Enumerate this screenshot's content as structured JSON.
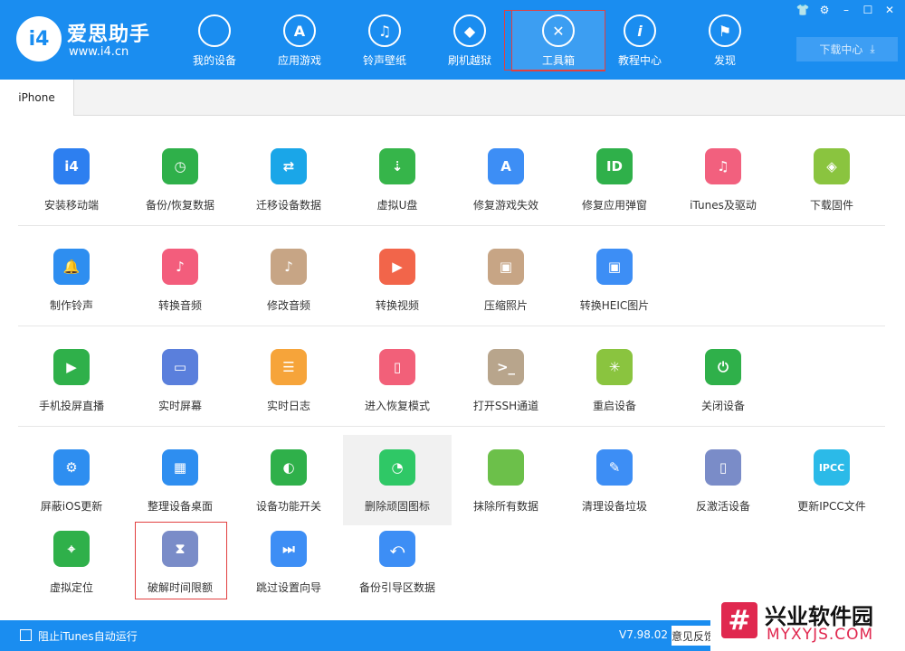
{
  "brand": {
    "logo_text": "i4",
    "name": "爱思助手",
    "url": "www.i4.cn"
  },
  "nav": [
    {
      "label": "我的设备",
      "icon": "apple-icon"
    },
    {
      "label": "应用游戏",
      "icon": "app-store-icon"
    },
    {
      "label": "铃声壁纸",
      "icon": "music-wallpaper-icon"
    },
    {
      "label": "刷机越狱",
      "icon": "dropbox-icon"
    },
    {
      "label": "工具箱",
      "icon": "tools-icon",
      "active": true
    },
    {
      "label": "教程中心",
      "icon": "info-icon"
    },
    {
      "label": "发现",
      "icon": "flag-icon"
    }
  ],
  "download_center": "下载中心",
  "tabs": [
    {
      "label": "iPhone"
    }
  ],
  "tools": [
    {
      "label": "安装移动端",
      "color": "#2d7ff0"
    },
    {
      "label": "备份/恢复数据",
      "color": "#2fb04a"
    },
    {
      "label": "迁移设备数据",
      "color": "#1aa6e8"
    },
    {
      "label": "虚拟U盘",
      "color": "#36b54a"
    },
    {
      "label": "修复游戏失效",
      "color": "#3d8ef5"
    },
    {
      "label": "修复应用弹窗",
      "color": "#2fb04a"
    },
    {
      "label": "iTunes及驱动",
      "color": "#f2607e"
    },
    {
      "label": "下载固件",
      "color": "#8ac43f"
    },
    {
      "label": "制作铃声",
      "color": "#2e8ef0"
    },
    {
      "label": "转换音频",
      "color": "#f35d7c"
    },
    {
      "label": "修改音频",
      "color": "#c7a585"
    },
    {
      "label": "转换视频",
      "color": "#f2654a"
    },
    {
      "label": "压缩照片",
      "color": "#c7a585"
    },
    {
      "label": "转换HEIC图片",
      "color": "#3d8ef5"
    },
    {
      "label": "手机投屏直播",
      "color": "#2fb04a"
    },
    {
      "label": "实时屏幕",
      "color": "#5a7fdc"
    },
    {
      "label": "实时日志",
      "color": "#f6a43a"
    },
    {
      "label": "进入恢复模式",
      "color": "#f26079"
    },
    {
      "label": "打开SSH通道",
      "color": "#b8a58c"
    },
    {
      "label": "重启设备",
      "color": "#8ac43f"
    },
    {
      "label": "关闭设备",
      "color": "#2fb04a"
    },
    {
      "label": "屏蔽iOS更新",
      "color": "#2e8ef0"
    },
    {
      "label": "整理设备桌面",
      "color": "#2e8ef0"
    },
    {
      "label": "设备功能开关",
      "color": "#2fb04a"
    },
    {
      "label": "删除顽固图标",
      "color": "#2fc866"
    },
    {
      "label": "抹除所有数据",
      "color": "#6cc04a"
    },
    {
      "label": "清理设备垃圾",
      "color": "#3d8ef5"
    },
    {
      "label": "反激活设备",
      "color": "#7a8cc8"
    },
    {
      "label": "更新IPCC文件",
      "color": "#2bbae8"
    },
    {
      "label": "虚拟定位",
      "color": "#2fb04a"
    },
    {
      "label": "破解时间限额",
      "color": "#7a8cc8"
    },
    {
      "label": "跳过设置向导",
      "color": "#3d8ef5"
    },
    {
      "label": "备份引导区数据",
      "color": "#3d8ef5"
    }
  ],
  "footer": {
    "itunes_block_label": "阻止iTunes自动运行",
    "version": "V7.98.02",
    "feedback": "意见反馈"
  },
  "watermark": {
    "title": "兴业软件园",
    "url": "MYXYJS.COM"
  }
}
